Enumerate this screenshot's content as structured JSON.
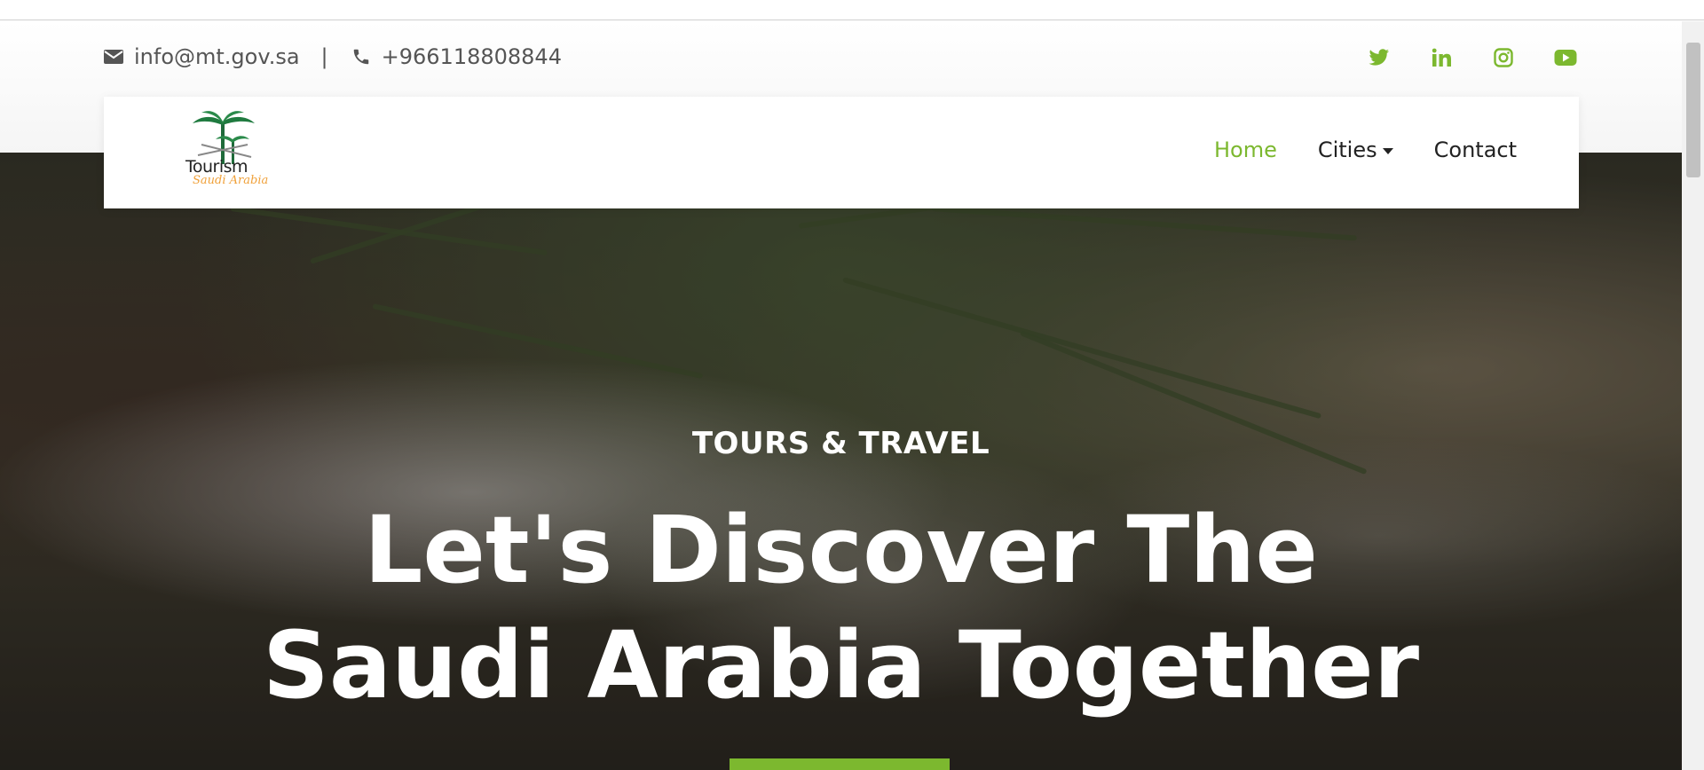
{
  "topbar": {
    "email": "info@mt.gov.sa",
    "separator": "|",
    "phone": "+966118808844",
    "icons": {
      "email": "envelope-icon",
      "phone": "phone-icon"
    },
    "social": [
      {
        "name": "twitter-icon"
      },
      {
        "name": "linkedin-icon"
      },
      {
        "name": "instagram-icon"
      },
      {
        "name": "youtube-icon"
      }
    ],
    "social_color": "#7cb82f"
  },
  "navbar": {
    "logo_title": "Tourism",
    "logo_subtitle": "Saudi Arabia",
    "links": [
      {
        "label": "Home",
        "active": true
      },
      {
        "label": "Cities",
        "dropdown": true
      },
      {
        "label": "Contact"
      }
    ],
    "active_color": "#7cb82f"
  },
  "hero": {
    "subtitle": "TOURS & TRAVEL",
    "title_line1": "Let's Discover The",
    "title_line2": "Saudi Arabia Together"
  },
  "colors": {
    "accent": "#7cb82f",
    "text_dark": "#222222",
    "text_muted": "#555555"
  }
}
